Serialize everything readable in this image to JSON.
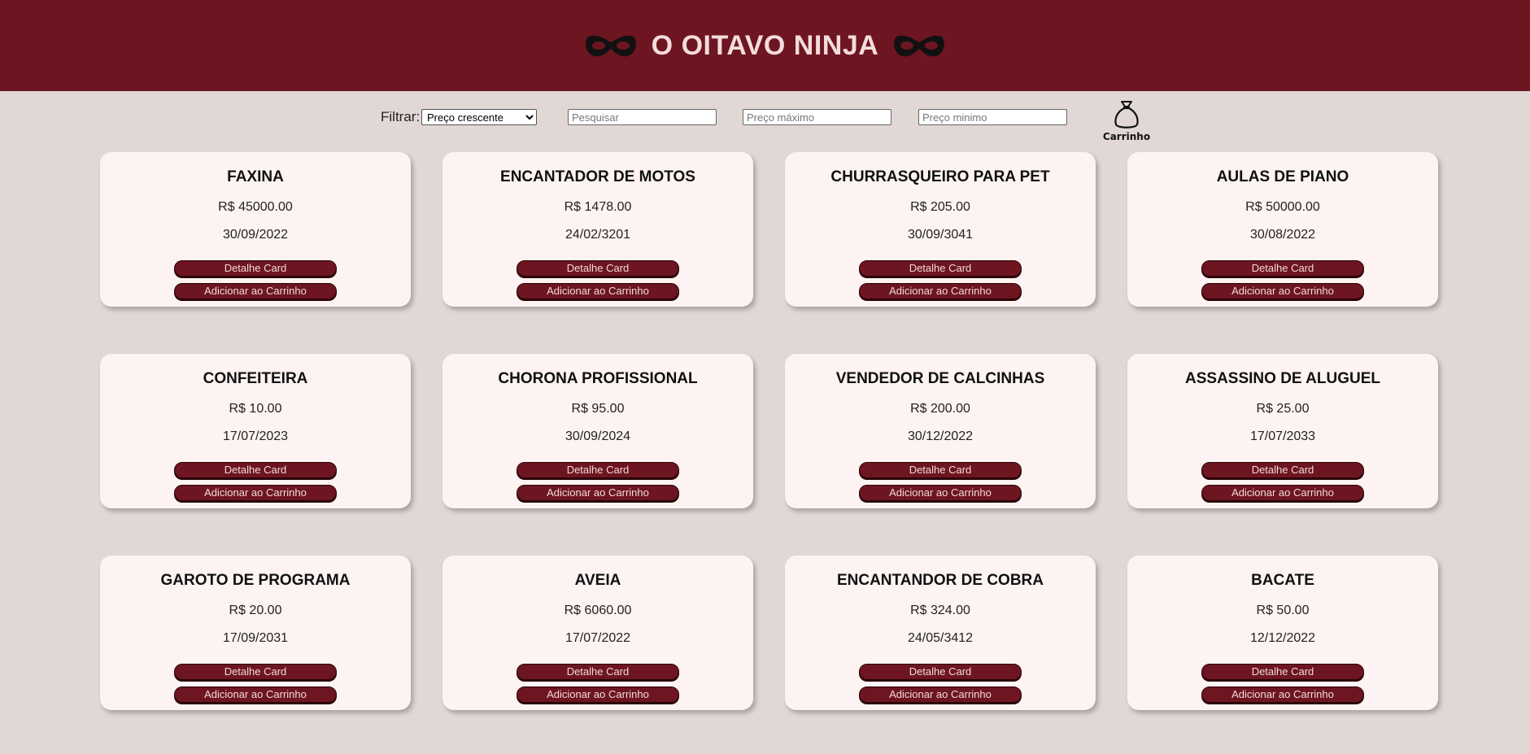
{
  "header": {
    "title": "O OITAVO NINJA",
    "left_icon": "ninja-mask-icon",
    "right_icon": "ninja-mask-icon"
  },
  "filters": {
    "filter_label": "Filtrar:",
    "sort_selected": "Preço crescente",
    "search_placeholder": "Pesquisar",
    "max_price_placeholder": "Preço máximo",
    "min_price_placeholder": "Preço minimo"
  },
  "cart": {
    "label": "Carrinho",
    "icon": "money-bag-icon"
  },
  "buttons": {
    "detail_label": "Detalhe Card",
    "add_label": "Adicionar ao Carrinho"
  },
  "colors": {
    "header_bg": "#6d1520",
    "page_bg": "#e1d8d6",
    "card_bg": "#fdf3f2",
    "button_bg": "#6d1520"
  },
  "cards": [
    {
      "title": "FAXINA",
      "price": "R$ 45000.00",
      "date": "30/09/2022"
    },
    {
      "title": "ENCANTADOR DE MOTOS",
      "price": "R$ 1478.00",
      "date": "24/02/3201"
    },
    {
      "title": "CHURRASQUEIRO PARA PET",
      "price": "R$ 205.00",
      "date": "30/09/3041"
    },
    {
      "title": "AULAS DE PIANO",
      "price": "R$ 50000.00",
      "date": "30/08/2022"
    },
    {
      "title": "CONFEITEIRA",
      "price": "R$ 10.00",
      "date": "17/07/2023"
    },
    {
      "title": "CHORONA PROFISSIONAL",
      "price": "R$ 95.00",
      "date": "30/09/2024"
    },
    {
      "title": "VENDEDOR DE CALCINHAS",
      "price": "R$ 200.00",
      "date": "30/12/2022"
    },
    {
      "title": "ASSASSINO DE ALUGUEL",
      "price": "R$ 25.00",
      "date": "17/07/2033"
    },
    {
      "title": "GAROTO DE PROGRAMA",
      "price": "R$ 20.00",
      "date": "17/09/2031"
    },
    {
      "title": "AVEIA",
      "price": "R$ 6060.00",
      "date": "17/07/2022"
    },
    {
      "title": "ENCANTANDOR DE COBRA",
      "price": "R$ 324.00",
      "date": "24/05/3412"
    },
    {
      "title": "BACATE",
      "price": "R$ 50.00",
      "date": "12/12/2022"
    }
  ]
}
